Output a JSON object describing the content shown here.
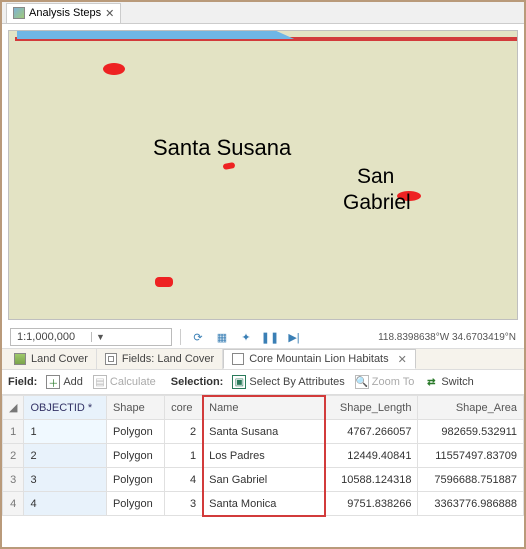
{
  "window": {
    "title": "Analysis Steps"
  },
  "map": {
    "labels": [
      "Santa Susana",
      "San",
      "Gabriel"
    ],
    "scale": "1:1,000,000",
    "coords": "118.8398638°W 34.6703419°N"
  },
  "viewTabs": {
    "landCover": "Land Cover",
    "fields": "Fields: Land Cover",
    "habitats": "Core Mountain Lion Habitats"
  },
  "actions": {
    "fieldLabel": "Field:",
    "add": "Add",
    "calculate": "Calculate",
    "selectionLabel": "Selection:",
    "selectByAttr": "Select By Attributes",
    "zoomTo": "Zoom To",
    "switch": "Switch"
  },
  "table": {
    "cols": {
      "objectId": "OBJECTID *",
      "shape": "Shape",
      "core": "core",
      "name": "Name",
      "shapeLength": "Shape_Length",
      "shapeArea": "Shape_Area"
    },
    "rows": [
      {
        "n": "1",
        "objectId": "1",
        "shape": "Polygon",
        "core": "2",
        "name": "Santa Susana",
        "len": "4767.266057",
        "area": "982659.532911"
      },
      {
        "n": "2",
        "objectId": "2",
        "shape": "Polygon",
        "core": "1",
        "name": "Los Padres",
        "len": "12449.40841",
        "area": "11557497.83709"
      },
      {
        "n": "3",
        "objectId": "3",
        "shape": "Polygon",
        "core": "4",
        "name": "San Gabriel",
        "len": "10588.124318",
        "area": "7596688.751887"
      },
      {
        "n": "4",
        "objectId": "4",
        "shape": "Polygon",
        "core": "3",
        "name": "Santa Monica",
        "len": "9751.838266",
        "area": "3363776.986888"
      }
    ]
  }
}
